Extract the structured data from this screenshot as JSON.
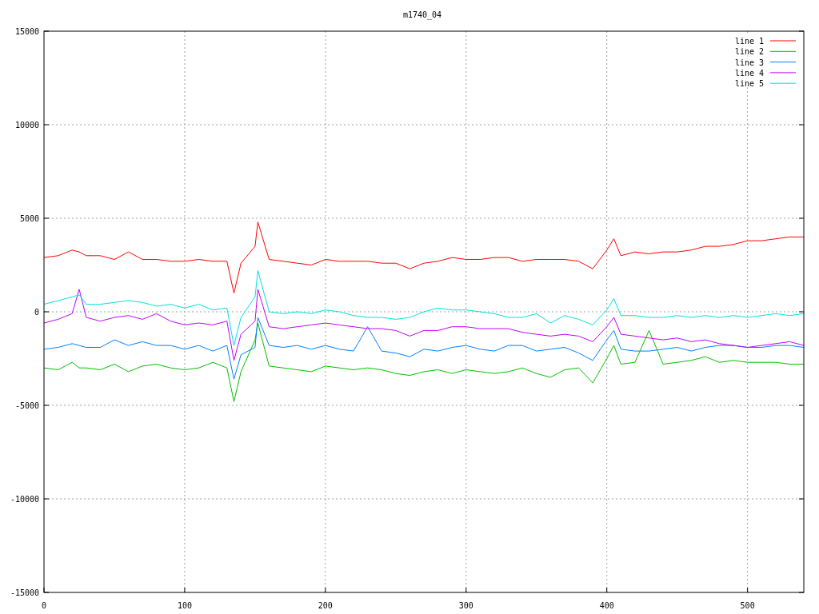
{
  "plot": {
    "chart_data": {
      "type": "line",
      "title": "m1740_04",
      "grid": true,
      "legend": true,
      "xlim": [
        0,
        540
      ],
      "ylim": [
        -15000,
        15000
      ],
      "xticks": [
        0,
        100,
        200,
        300,
        400,
        500
      ],
      "yticks": [
        -15000,
        -10000,
        -5000,
        0,
        5000,
        10000,
        15000
      ],
      "x": [
        0,
        10,
        20,
        25,
        30,
        40,
        50,
        60,
        70,
        80,
        90,
        100,
        110,
        120,
        130,
        135,
        140,
        150,
        152,
        160,
        170,
        180,
        190,
        200,
        210,
        220,
        230,
        240,
        250,
        260,
        270,
        280,
        290,
        300,
        310,
        320,
        330,
        340,
        350,
        360,
        370,
        380,
        390,
        400,
        405,
        410,
        420,
        430,
        440,
        450,
        460,
        470,
        480,
        490,
        500,
        510,
        520,
        530,
        540
      ],
      "series": [
        {
          "name": "line 1",
          "color": "#ff0000",
          "values": [
            2900,
            3000,
            3300,
            3200,
            3000,
            3000,
            2800,
            3200,
            2800,
            2800,
            2700,
            2700,
            2800,
            2700,
            2700,
            1000,
            2600,
            3500,
            4800,
            2800,
            2700,
            2600,
            2500,
            2800,
            2700,
            2700,
            2700,
            2600,
            2600,
            2300,
            2600,
            2700,
            2900,
            2800,
            2800,
            2900,
            2900,
            2700,
            2800,
            2800,
            2800,
            2700,
            2300,
            3300,
            3900,
            3000,
            3200,
            3100,
            3200,
            3200,
            3300,
            3500,
            3500,
            3600,
            3800,
            3800,
            3900,
            4000,
            4000
          ]
        },
        {
          "name": "line 2",
          "color": "#00c000",
          "values": [
            -3000,
            -3100,
            -2700,
            -3000,
            -3000,
            -3100,
            -2800,
            -3200,
            -2900,
            -2800,
            -3000,
            -3100,
            -3000,
            -2700,
            -3000,
            -4800,
            -3200,
            -1500,
            -600,
            -2900,
            -3000,
            -3100,
            -3200,
            -2900,
            -3000,
            -3100,
            -3000,
            -3100,
            -3300,
            -3400,
            -3200,
            -3100,
            -3300,
            -3100,
            -3200,
            -3300,
            -3200,
            -3000,
            -3300,
            -3500,
            -3100,
            -3000,
            -3800,
            -2500,
            -1800,
            -2800,
            -2700,
            -1000,
            -2800,
            -2700,
            -2600,
            -2400,
            -2700,
            -2600,
            -2700,
            -2700,
            -2700,
            -2800,
            -2800
          ]
        },
        {
          "name": "line 3",
          "color": "#0080ff",
          "values": [
            -2000,
            -1900,
            -1700,
            -1800,
            -1900,
            -1900,
            -1500,
            -1800,
            -1600,
            -1800,
            -1800,
            -2000,
            -1800,
            -2100,
            -1800,
            -3600,
            -2300,
            -1900,
            -300,
            -1800,
            -1900,
            -1800,
            -2000,
            -1800,
            -2000,
            -2100,
            -800,
            -2100,
            -2200,
            -2400,
            -2000,
            -2100,
            -1900,
            -1800,
            -2000,
            -2100,
            -1800,
            -1800,
            -2100,
            -2000,
            -1900,
            -2200,
            -2600,
            -1500,
            -1000,
            -2000,
            -2100,
            -2100,
            -2000,
            -1900,
            -2100,
            -1900,
            -1800,
            -1800,
            -1900,
            -1900,
            -1800,
            -1800,
            -1900
          ]
        },
        {
          "name": "line 4",
          "color": "#c000ff",
          "values": [
            -600,
            -400,
            -100,
            1200,
            -300,
            -500,
            -300,
            -200,
            -400,
            -100,
            -500,
            -700,
            -600,
            -700,
            -500,
            -2600,
            -1200,
            -500,
            1200,
            -800,
            -900,
            -800,
            -700,
            -600,
            -700,
            -800,
            -900,
            -900,
            -1000,
            -1300,
            -1000,
            -1000,
            -800,
            -800,
            -900,
            -900,
            -900,
            -1100,
            -1200,
            -1300,
            -1200,
            -1300,
            -1600,
            -800,
            -300,
            -1200,
            -1300,
            -1400,
            -1500,
            -1400,
            -1600,
            -1500,
            -1700,
            -1800,
            -1900,
            -1800,
            -1700,
            -1600,
            -1800
          ]
        },
        {
          "name": "line 5",
          "color": "#00e0e0",
          "values": [
            400,
            600,
            800,
            900,
            400,
            400,
            500,
            600,
            500,
            300,
            400,
            200,
            400,
            100,
            200,
            -1800,
            -300,
            800,
            2200,
            0,
            -100,
            0,
            -100,
            100,
            0,
            -200,
            -300,
            -300,
            -400,
            -300,
            0,
            200,
            100,
            100,
            0,
            -100,
            -300,
            -300,
            -100,
            -600,
            -200,
            -400,
            -700,
            100,
            700,
            -200,
            -200,
            -300,
            -300,
            -200,
            -300,
            -200,
            -300,
            -200,
            -300,
            -200,
            -100,
            -200,
            -100
          ]
        }
      ]
    }
  }
}
